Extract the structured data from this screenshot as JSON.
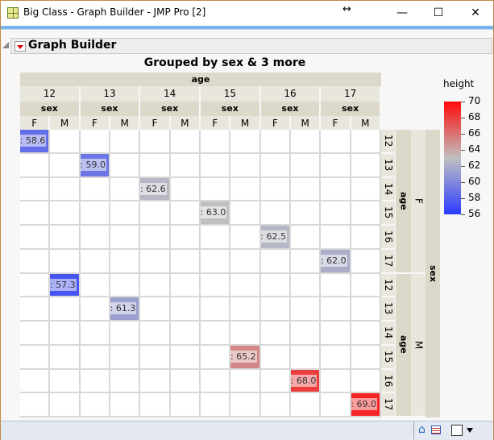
{
  "window": {
    "title": "Big Class - Graph Builder - JMP Pro [2]",
    "resize_glyph": "↔",
    "minimize": "—",
    "maximize": "☐",
    "close": "✕"
  },
  "panel": {
    "title": "Graph Builder"
  },
  "graph": {
    "title": "Grouped by sex & 3 more",
    "x_group_label": "age",
    "x_sub_label": "sex",
    "y_group_label": "sex",
    "y_sub_label": "age",
    "ages": [
      "12",
      "13",
      "14",
      "15",
      "16",
      "17"
    ],
    "sexes": [
      "F",
      "M"
    ],
    "label_prefix": "Mean: "
  },
  "chart_data": {
    "type": "heatmap",
    "statistic": "mean height",
    "rows": [
      {
        "sex": "F",
        "values": [
          58.6,
          59.0,
          62.6,
          63.0,
          62.5,
          62.0
        ]
      },
      {
        "sex": "M",
        "values": [
          57.3,
          61.3,
          null,
          65.2,
          68.0,
          69.0
        ]
      }
    ],
    "labels": {
      "F": [
        "58.6",
        "59.0",
        "62.6",
        "63.0",
        "62.5",
        "62.0"
      ],
      "M": [
        "57.3",
        "61.3",
        "",
        "65.2",
        "68.0",
        "69.0"
      ]
    }
  },
  "legend": {
    "title": "height",
    "ticks": [
      "70",
      "68",
      "66",
      "64",
      "62",
      "60",
      "58",
      "56"
    ],
    "min": 56,
    "max": 70,
    "colors": {
      "low": "#2b3cff",
      "mid": "#c0c0c0",
      "high": "#ff0a0a"
    }
  },
  "statusbar": {
    "icons": [
      "home-icon",
      "data-table-icon",
      "square-icon",
      "dropdown-arrow-icon"
    ]
  }
}
